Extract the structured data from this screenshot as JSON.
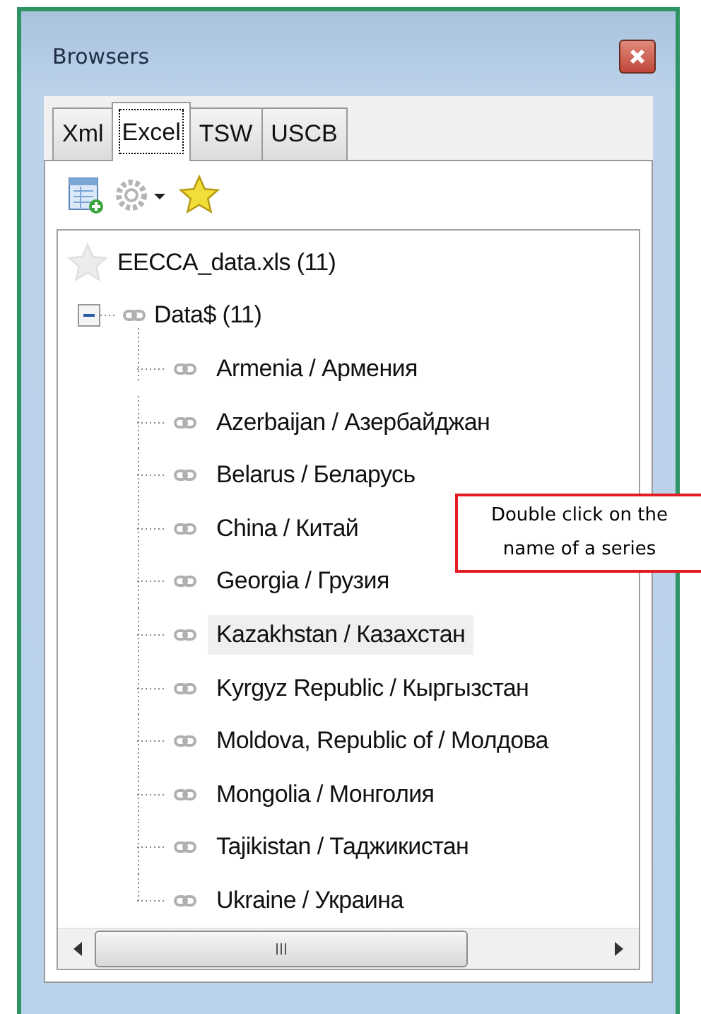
{
  "window": {
    "title": "Browsers"
  },
  "tabs": [
    {
      "label": "Xml",
      "selected": false
    },
    {
      "label": "Excel",
      "selected": true
    },
    {
      "label": "TSW",
      "selected": false
    },
    {
      "label": "USCB",
      "selected": false
    }
  ],
  "tree": {
    "label": "EECCA_data.xls (11)",
    "children": [
      {
        "label": "Data$ (11)",
        "expanded": true,
        "children": [
          {
            "label": "Armenia / Армения",
            "selected": false
          },
          {
            "label": "Azerbaijan / Азербайджан",
            "selected": false
          },
          {
            "label": "Belarus / Беларусь",
            "selected": false
          },
          {
            "label": "China / Китай",
            "selected": false
          },
          {
            "label": "Georgia / Грузия",
            "selected": false
          },
          {
            "label": "Kazakhstan / Казахстан",
            "selected": true
          },
          {
            "label": "Kyrgyz Republic / Кыргызстан",
            "selected": false
          },
          {
            "label": "Moldova, Republic of / Молдова",
            "selected": false
          },
          {
            "label": "Mongolia / Монголия",
            "selected": false
          },
          {
            "label": "Tajikistan / Таджикистан",
            "selected": false
          },
          {
            "label": "Ukraine / Украина",
            "selected": false
          }
        ]
      }
    ]
  },
  "callout": {
    "text": "Double click on the name of a series"
  }
}
